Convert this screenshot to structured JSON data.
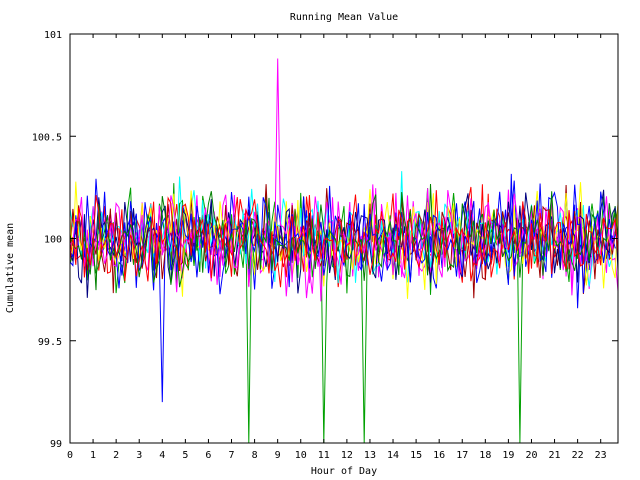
{
  "chart_data": {
    "type": "line",
    "title": "Running Mean Value",
    "xlabel": "Hour of Day",
    "ylabel": "Cumulative mean",
    "xlim": [
      0,
      23.75
    ],
    "ylim": [
      99,
      101
    ],
    "x_ticks": [
      "0",
      "1",
      "2",
      "3",
      "4",
      "5",
      "6",
      "7",
      "8",
      "9",
      "10",
      "11",
      "12",
      "13",
      "14",
      "15",
      "16",
      "17",
      "18",
      "19",
      "20",
      "21",
      "22",
      "23"
    ],
    "y_ticks": [
      "99",
      "99.5",
      "100",
      "100.5",
      "101"
    ],
    "grid": false,
    "legend": "none",
    "series_colors": [
      "#ff0000",
      "#00a000",
      "#0000ff",
      "#ff00ff",
      "#00ffff",
      "#a00000",
      "#ffff00",
      "#000080",
      "#ff00ff",
      "#0000ff",
      "#008000",
      "#ff0000"
    ],
    "notable_values": {
      "max": 100.88,
      "max_at_hour": 9.0,
      "min_visible": 99.2,
      "min_visible_at_hour": 3.95,
      "drops_to_axis_floor_at_hours": [
        7.7,
        11.0,
        12.7,
        19.5
      ]
    }
  }
}
